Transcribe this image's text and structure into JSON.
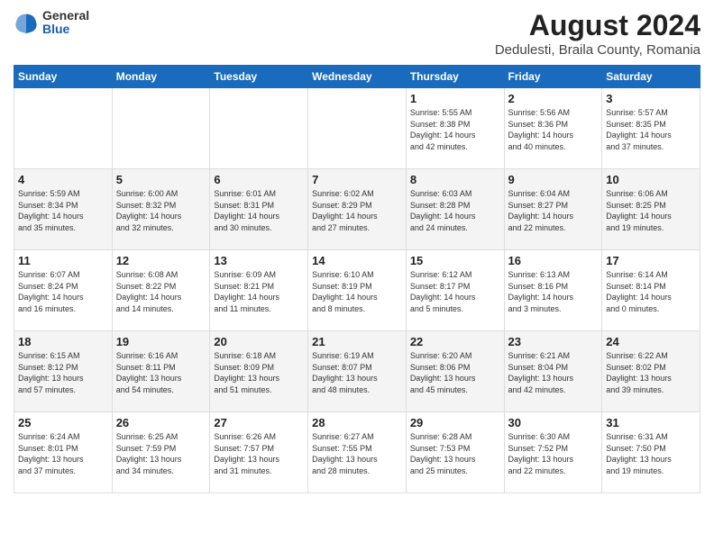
{
  "header": {
    "logo_general": "General",
    "logo_blue": "Blue",
    "title": "August 2024",
    "subtitle": "Dedulesti, Braila County, Romania"
  },
  "days_of_week": [
    "Sunday",
    "Monday",
    "Tuesday",
    "Wednesday",
    "Thursday",
    "Friday",
    "Saturday"
  ],
  "weeks": [
    [
      {
        "day": "",
        "info": ""
      },
      {
        "day": "",
        "info": ""
      },
      {
        "day": "",
        "info": ""
      },
      {
        "day": "",
        "info": ""
      },
      {
        "day": "1",
        "info": "Sunrise: 5:55 AM\nSunset: 8:38 PM\nDaylight: 14 hours\nand 42 minutes."
      },
      {
        "day": "2",
        "info": "Sunrise: 5:56 AM\nSunset: 8:36 PM\nDaylight: 14 hours\nand 40 minutes."
      },
      {
        "day": "3",
        "info": "Sunrise: 5:57 AM\nSunset: 8:35 PM\nDaylight: 14 hours\nand 37 minutes."
      }
    ],
    [
      {
        "day": "4",
        "info": "Sunrise: 5:59 AM\nSunset: 8:34 PM\nDaylight: 14 hours\nand 35 minutes."
      },
      {
        "day": "5",
        "info": "Sunrise: 6:00 AM\nSunset: 8:32 PM\nDaylight: 14 hours\nand 32 minutes."
      },
      {
        "day": "6",
        "info": "Sunrise: 6:01 AM\nSunset: 8:31 PM\nDaylight: 14 hours\nand 30 minutes."
      },
      {
        "day": "7",
        "info": "Sunrise: 6:02 AM\nSunset: 8:29 PM\nDaylight: 14 hours\nand 27 minutes."
      },
      {
        "day": "8",
        "info": "Sunrise: 6:03 AM\nSunset: 8:28 PM\nDaylight: 14 hours\nand 24 minutes."
      },
      {
        "day": "9",
        "info": "Sunrise: 6:04 AM\nSunset: 8:27 PM\nDaylight: 14 hours\nand 22 minutes."
      },
      {
        "day": "10",
        "info": "Sunrise: 6:06 AM\nSunset: 8:25 PM\nDaylight: 14 hours\nand 19 minutes."
      }
    ],
    [
      {
        "day": "11",
        "info": "Sunrise: 6:07 AM\nSunset: 8:24 PM\nDaylight: 14 hours\nand 16 minutes."
      },
      {
        "day": "12",
        "info": "Sunrise: 6:08 AM\nSunset: 8:22 PM\nDaylight: 14 hours\nand 14 minutes."
      },
      {
        "day": "13",
        "info": "Sunrise: 6:09 AM\nSunset: 8:21 PM\nDaylight: 14 hours\nand 11 minutes."
      },
      {
        "day": "14",
        "info": "Sunrise: 6:10 AM\nSunset: 8:19 PM\nDaylight: 14 hours\nand 8 minutes."
      },
      {
        "day": "15",
        "info": "Sunrise: 6:12 AM\nSunset: 8:17 PM\nDaylight: 14 hours\nand 5 minutes."
      },
      {
        "day": "16",
        "info": "Sunrise: 6:13 AM\nSunset: 8:16 PM\nDaylight: 14 hours\nand 3 minutes."
      },
      {
        "day": "17",
        "info": "Sunrise: 6:14 AM\nSunset: 8:14 PM\nDaylight: 14 hours\nand 0 minutes."
      }
    ],
    [
      {
        "day": "18",
        "info": "Sunrise: 6:15 AM\nSunset: 8:12 PM\nDaylight: 13 hours\nand 57 minutes."
      },
      {
        "day": "19",
        "info": "Sunrise: 6:16 AM\nSunset: 8:11 PM\nDaylight: 13 hours\nand 54 minutes."
      },
      {
        "day": "20",
        "info": "Sunrise: 6:18 AM\nSunset: 8:09 PM\nDaylight: 13 hours\nand 51 minutes."
      },
      {
        "day": "21",
        "info": "Sunrise: 6:19 AM\nSunset: 8:07 PM\nDaylight: 13 hours\nand 48 minutes."
      },
      {
        "day": "22",
        "info": "Sunrise: 6:20 AM\nSunset: 8:06 PM\nDaylight: 13 hours\nand 45 minutes."
      },
      {
        "day": "23",
        "info": "Sunrise: 6:21 AM\nSunset: 8:04 PM\nDaylight: 13 hours\nand 42 minutes."
      },
      {
        "day": "24",
        "info": "Sunrise: 6:22 AM\nSunset: 8:02 PM\nDaylight: 13 hours\nand 39 minutes."
      }
    ],
    [
      {
        "day": "25",
        "info": "Sunrise: 6:24 AM\nSunset: 8:01 PM\nDaylight: 13 hours\nand 37 minutes."
      },
      {
        "day": "26",
        "info": "Sunrise: 6:25 AM\nSunset: 7:59 PM\nDaylight: 13 hours\nand 34 minutes."
      },
      {
        "day": "27",
        "info": "Sunrise: 6:26 AM\nSunset: 7:57 PM\nDaylight: 13 hours\nand 31 minutes."
      },
      {
        "day": "28",
        "info": "Sunrise: 6:27 AM\nSunset: 7:55 PM\nDaylight: 13 hours\nand 28 minutes."
      },
      {
        "day": "29",
        "info": "Sunrise: 6:28 AM\nSunset: 7:53 PM\nDaylight: 13 hours\nand 25 minutes."
      },
      {
        "day": "30",
        "info": "Sunrise: 6:30 AM\nSunset: 7:52 PM\nDaylight: 13 hours\nand 22 minutes."
      },
      {
        "day": "31",
        "info": "Sunrise: 6:31 AM\nSunset: 7:50 PM\nDaylight: 13 hours\nand 19 minutes."
      }
    ]
  ]
}
